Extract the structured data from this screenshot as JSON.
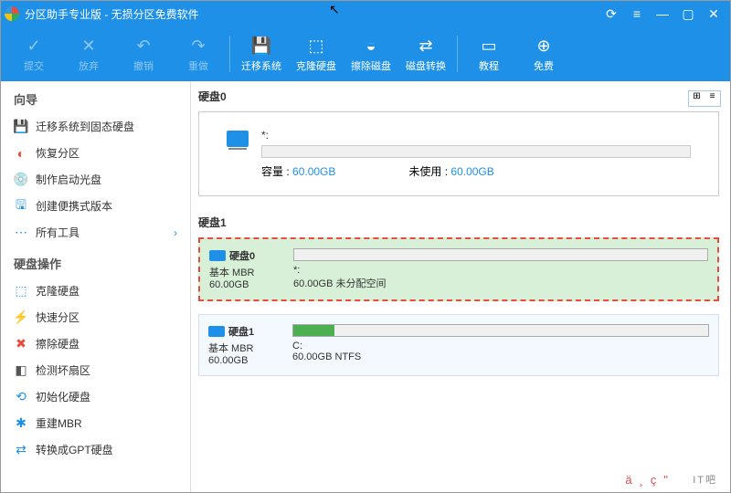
{
  "title": "分区助手专业版 - 无损分区免费软件",
  "toolbar": [
    {
      "label": "提交",
      "icon": "✓",
      "disabled": true
    },
    {
      "label": "放弃",
      "icon": "✕",
      "disabled": true
    },
    {
      "label": "撤销",
      "icon": "↶",
      "disabled": true
    },
    {
      "label": "重做",
      "icon": "↷",
      "disabled": true
    },
    {
      "sep": true
    },
    {
      "label": "迁移系统",
      "icon": "💾"
    },
    {
      "label": "克隆硬盘",
      "icon": "⬚"
    },
    {
      "label": "擦除磁盘",
      "icon": "◒"
    },
    {
      "label": "磁盘转换",
      "icon": "⇄"
    },
    {
      "sep": true
    },
    {
      "label": "教程",
      "icon": "▭"
    },
    {
      "label": "免费",
      "icon": "⊕"
    }
  ],
  "sidebar": {
    "group1": "向导",
    "items1": [
      {
        "icon": "💾",
        "color": "#1e90e8",
        "label": "迁移系统到固态硬盘"
      },
      {
        "icon": "◐",
        "color": "#e74c3c",
        "label": "恢复分区"
      },
      {
        "icon": "💿",
        "color": "#1e90e8",
        "label": "制作启动光盘"
      },
      {
        "icon": "🖫",
        "color": "#1e90e8",
        "label": "创建便携式版本"
      },
      {
        "icon": "⋯",
        "color": "#1e90e8",
        "label": "所有工具",
        "chev": "›"
      }
    ],
    "group2": "硬盘操作",
    "items2": [
      {
        "icon": "⬚",
        "color": "#1e90e8",
        "label": "克隆硬盘"
      },
      {
        "icon": "⚡",
        "color": "#f39c12",
        "label": "快速分区"
      },
      {
        "icon": "✖",
        "color": "#e74c3c",
        "label": "擦除硬盘"
      },
      {
        "icon": "◧",
        "color": "#555",
        "label": "检测坏扇区"
      },
      {
        "icon": "⟲",
        "color": "#1e90e8",
        "label": "初始化硬盘"
      },
      {
        "icon": "✱",
        "color": "#1e90e8",
        "label": "重建MBR"
      },
      {
        "icon": "⇄",
        "color": "#1e90e8",
        "label": "转换成GPT硬盘"
      }
    ]
  },
  "disks": {
    "d0": {
      "title": "硬盘0",
      "name": "*:",
      "capLabel": "容量 :",
      "capVal": "60.00GB",
      "unusedLabel": "未使用 :",
      "unusedVal": "60.00GB"
    },
    "d1title": "硬盘1",
    "layout": [
      {
        "name": "硬盘0",
        "type": "基本 MBR",
        "size": "60.00GB",
        "part": "*:",
        "desc": "60.00GB 未分配空间",
        "selected": true,
        "green": false
      },
      {
        "name": "硬盘1",
        "type": "基本 MBR",
        "size": "60.00GB",
        "part": "C:",
        "desc": "60.00GB NTFS",
        "selected": false,
        "green": true
      }
    ]
  },
  "footerSyms": "ä¸­ç\"",
  "watermark": "IT吧"
}
